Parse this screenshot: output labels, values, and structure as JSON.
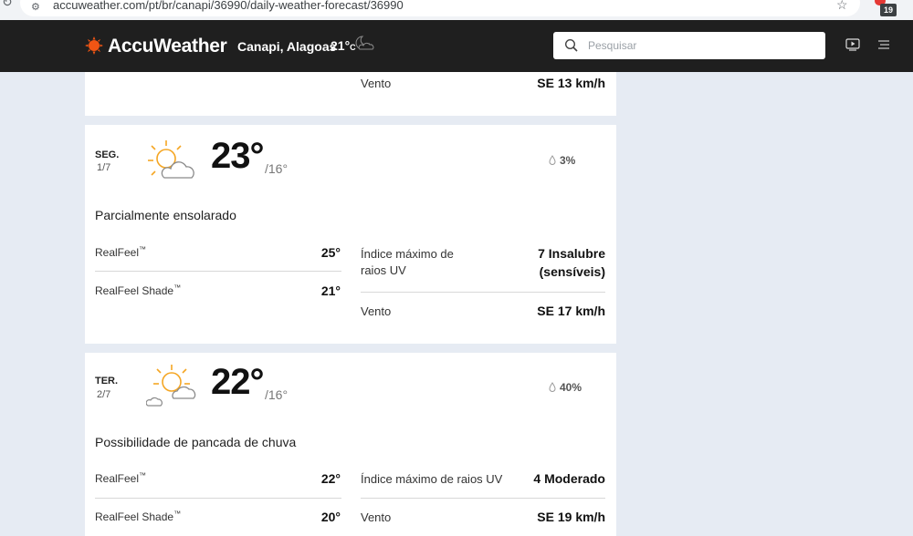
{
  "browser": {
    "url": "accuweather.com/pt/br/canapi/36990/daily-weather-forecast/36990",
    "extension_badge": "19"
  },
  "header": {
    "brand": "AccuWeather",
    "location": "Canapi, Alagoas",
    "current_temp": "21°",
    "current_unit": "C",
    "search_placeholder": "Pesquisar"
  },
  "top_card": {
    "wind_label": "Vento",
    "wind_value": "SE 13 km/h"
  },
  "days": [
    {
      "day": "SEG.",
      "date": "1/7",
      "high": "23°",
      "low": "/16°",
      "precip": "3%",
      "phrase": "Parcialmente ensolarado",
      "realfeel_label": "RealFeel",
      "realfeel_value": "25°",
      "realfeel_shade_label": "RealFeel Shade",
      "realfeel_shade_value": "21°",
      "uv_label": "Índice máximo de raios UV",
      "uv_value": "7 Insalubre (sensíveis)",
      "wind_label": "Vento",
      "wind_value": "SE 17 km/h",
      "icon": "partly-sunny-icon"
    },
    {
      "day": "TER.",
      "date": "2/7",
      "high": "22°",
      "low": "/16°",
      "precip": "40%",
      "phrase": "Possibilidade de pancada de chuva",
      "realfeel_label": "RealFeel",
      "realfeel_value": "22°",
      "realfeel_shade_label": "RealFeel Shade",
      "realfeel_shade_value": "20°",
      "uv_label": "Índice máximo de raios UV",
      "uv_value": "4 Moderado",
      "wind_label": "Vento",
      "wind_value": "SE 19 km/h",
      "icon": "sun-cloud-shower-icon"
    }
  ],
  "colors": {
    "header_bg": "#1f1f1f",
    "page_bg": "#e6ebf3",
    "brand_orange": "#f05514",
    "icon_orange": "#f5a623"
  }
}
